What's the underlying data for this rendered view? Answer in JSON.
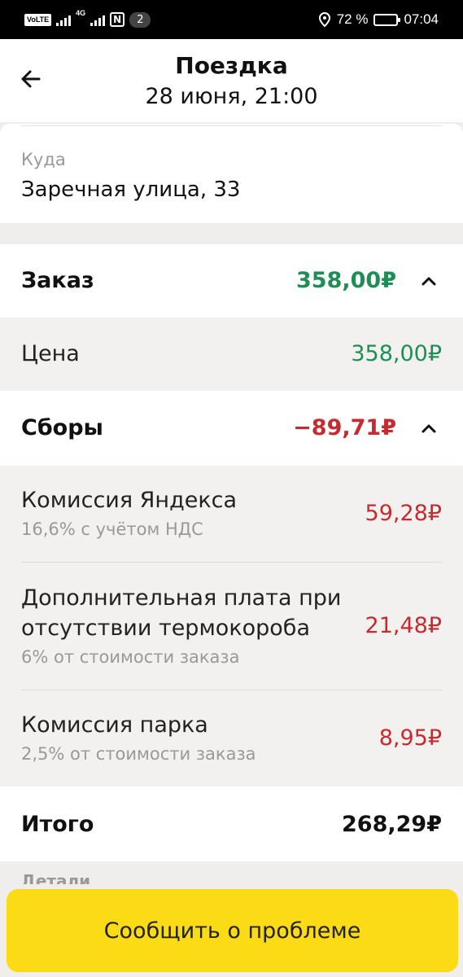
{
  "status_bar": {
    "volte": "VoLTE",
    "network": "4G",
    "notification_count": "2",
    "battery_percent": "72 %",
    "battery_level": 0.72,
    "time": "07:04"
  },
  "header": {
    "title": "Поездка",
    "subtitle": "28 июня, 21:00"
  },
  "destination": {
    "label": "Куда",
    "value": "Заречная улица, 33"
  },
  "order": {
    "label": "Заказ",
    "amount": "358,00₽"
  },
  "price": {
    "label": "Цена",
    "amount": "358,00₽"
  },
  "fees": {
    "label": "Сборы",
    "amount": "−89,71₽",
    "items": [
      {
        "name": "Комиссия Яндекса",
        "note": "16,6% с учётом НДС",
        "amount": "59,28₽"
      },
      {
        "name_line1": "Дополнительная плата при",
        "name_line2": "отсутствии термокороба",
        "note": "6% от стоимости заказа",
        "amount": "21,48₽"
      },
      {
        "name": "Комиссия парка",
        "note": "2,5% от стоимости заказа",
        "amount": "8,95₽"
      }
    ]
  },
  "total": {
    "label": "Итого",
    "amount": "268,29₽"
  },
  "details_label": "Детали",
  "report_button": "Сообщить о проблеме",
  "colors": {
    "accent_yellow": "#fadb15",
    "positive_green": "#1e8e55",
    "negative_red": "#c62b2f"
  }
}
